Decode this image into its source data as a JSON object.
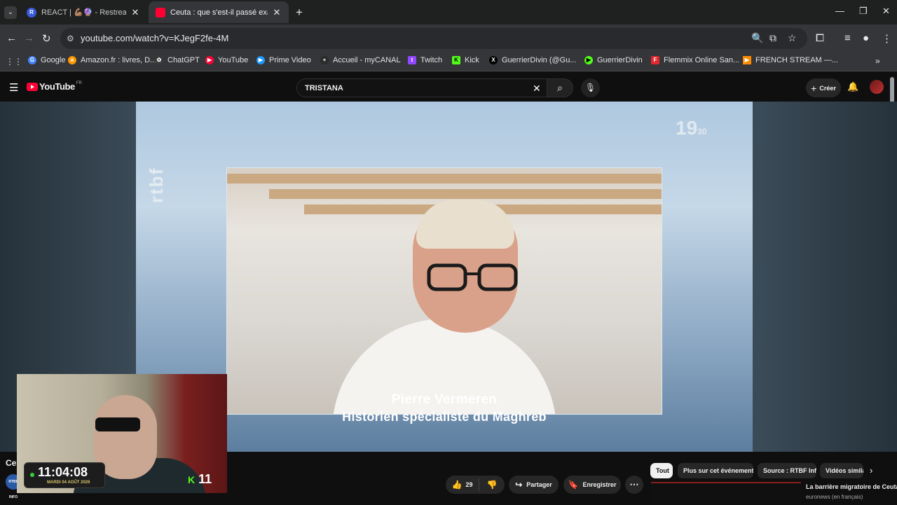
{
  "browser": {
    "tabs": [
      {
        "title": "REACT | 💪🏽🔮 - Restream",
        "favicon_letter": "R",
        "active": false
      },
      {
        "title": "Ceuta : que s'est-il passé exacte",
        "active": true
      }
    ],
    "url": "youtube.com/watch?v=KJegF2fe-4M",
    "bookmarks": [
      {
        "label": "Google",
        "color": "#4285f4"
      },
      {
        "label": "Amazon.fr : livres, D...",
        "color": "#ff9900"
      },
      {
        "label": "ChatGPT",
        "color": "#3a3a3a"
      },
      {
        "label": "YouTube",
        "color": "#ff0033"
      },
      {
        "label": "Prime Video",
        "color": "#1a98ff"
      },
      {
        "label": "Accueil - myCANAL",
        "color": "#2b2b2b"
      },
      {
        "label": "Twitch",
        "color": "#9146ff"
      },
      {
        "label": "Kick",
        "color": "#53fc18"
      },
      {
        "label": "GuerrierDivin (@Gu...",
        "color": "#000000"
      },
      {
        "label": "GuerrierDivin",
        "color": "#53fc18"
      },
      {
        "label": "Flemmix Online San...",
        "color": "#e0282e"
      },
      {
        "label": "FRENCH STREAM —...",
        "color": "#ff8a00"
      }
    ]
  },
  "youtube": {
    "logo_text": "YouTube",
    "country_code": "FR",
    "search_query": "TRISTANA",
    "create_label": "Créer"
  },
  "video": {
    "channel_watermark": "rtbf",
    "program_logo": "19",
    "program_logo_small": "30",
    "lower_third_name": "Pierre Vermeren",
    "lower_third_title": "Historien spécialiste du Maghreb"
  },
  "overlay": {
    "time": "11:04:08",
    "date": "MARDI 04 AOÛT 2026",
    "kick_count": "11"
  },
  "below": {
    "title_truncated": "Ceu",
    "channel_avatar_text": "RTBF INFO",
    "like_count": "29",
    "share_label": "Partager",
    "save_label": "Enregistrer"
  },
  "sidebar": {
    "chips": [
      "Tout",
      "Plus sur cet événement",
      "Source : RTBF Info",
      "Vidéos similaires"
    ],
    "reco_title": "La barrière migratoire de Ceuta",
    "reco_channel": "euronews (en français)"
  }
}
